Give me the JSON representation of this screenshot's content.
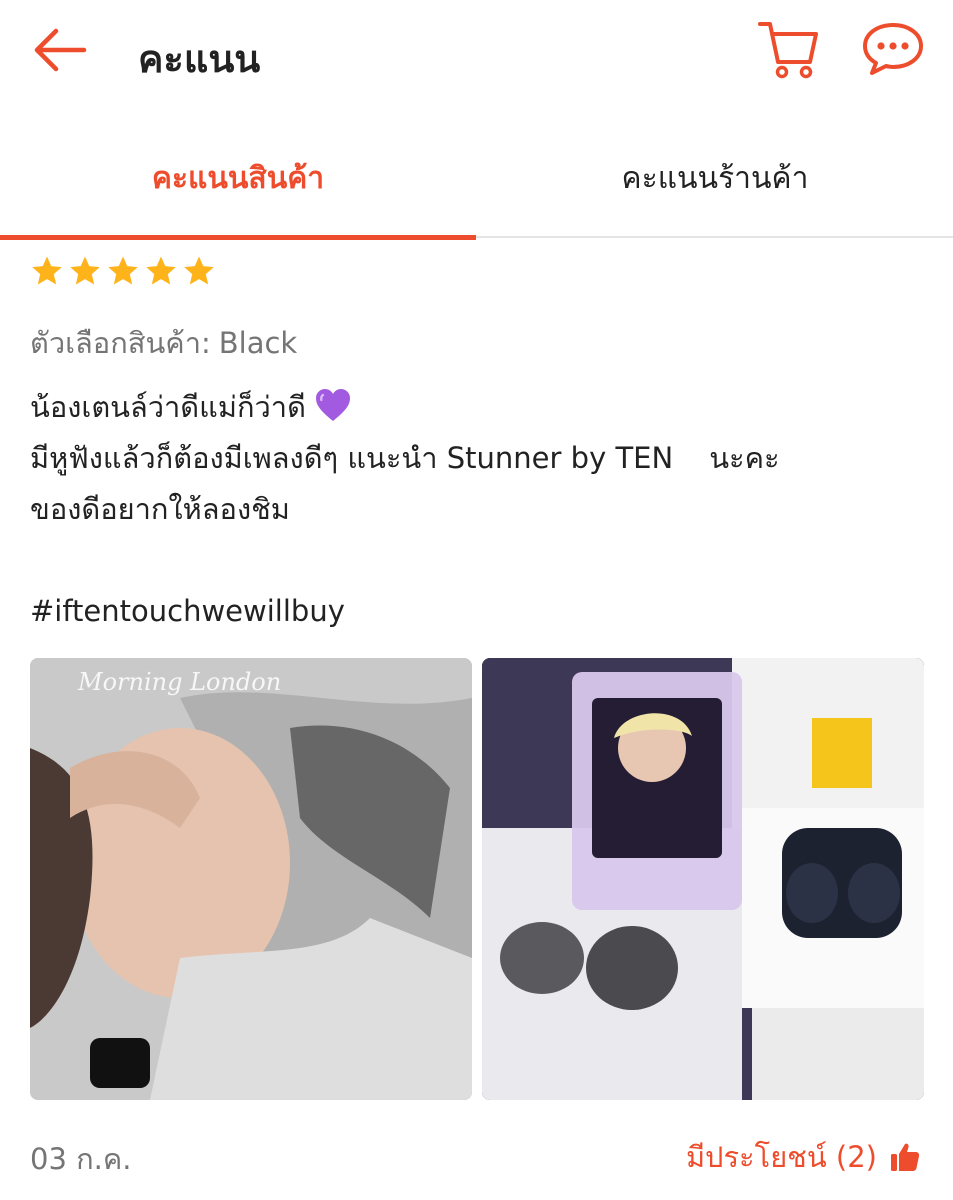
{
  "header": {
    "title": "คะแนน",
    "back_icon": "arrow-left-icon",
    "cart_icon": "cart-icon",
    "chat_icon": "chat-icon",
    "accent_color": "#ee4d2d"
  },
  "tabs": [
    {
      "label": "คะแนนสินค้า",
      "active": true
    },
    {
      "label": "คะแนนร้านค้า",
      "active": false
    }
  ],
  "review": {
    "rating": 5,
    "rating_max": 5,
    "star_color": "#ffb31a",
    "variant_label": "ตัวเลือกสินค้า:",
    "variant_value": "Black",
    "lines": [
      "น้องเตนล์ว่าดีแม่ก็ว่าดี",
      "มีหูฟังแล้วก็ต้องมีเพลงดีๆ แนะนำ Stunner by TEN",
      "นะคะ",
      "ของดีอยากให้ลองชิม",
      "#iftentouchwewillbuy"
    ],
    "heart_emoji_icon": "purple-heart-icon",
    "photos": [
      {
        "caption": "Morning London"
      },
      {
        "caption": ""
      }
    ],
    "date": "03 ก.ค.",
    "helpful_label": "มีประโยชน์ (2)",
    "helpful_icon": "thumbs-up-icon"
  }
}
